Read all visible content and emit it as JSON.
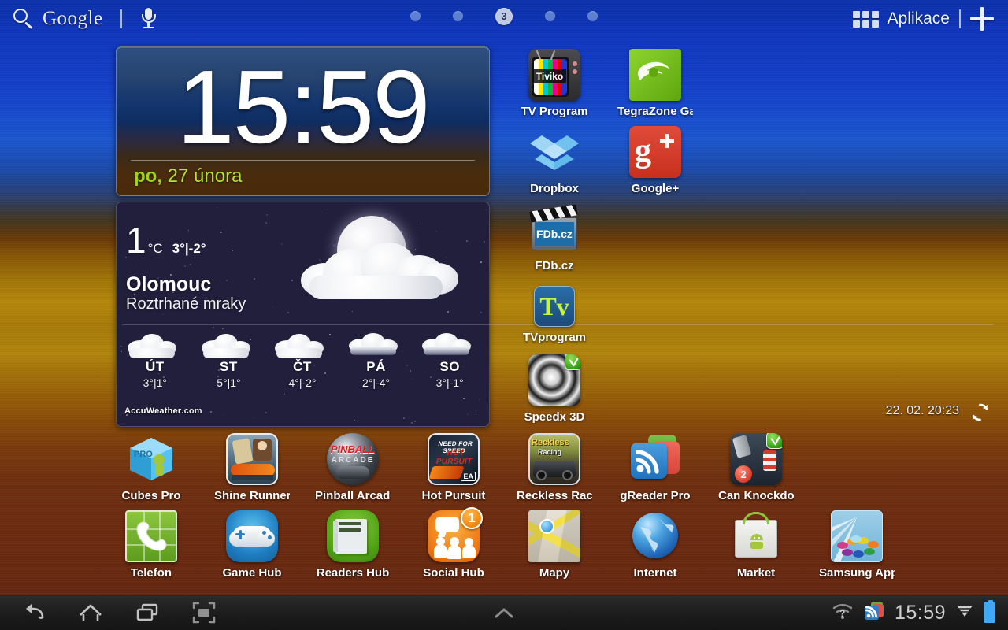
{
  "topbar": {
    "google_label": "Google",
    "search_icon": "search-icon",
    "mic_icon": "microphone-icon",
    "apps_label": "Aplikace",
    "apps_grid_icon": "apps-grid-icon",
    "add_icon": "plus-icon",
    "page_dots": [
      "",
      "",
      "3",
      "",
      ""
    ],
    "active_page": "3",
    "active_page_index": 2
  },
  "clock_widget": {
    "time": "15:59",
    "day_of_week": "po,",
    "date": "27 února"
  },
  "weather_widget": {
    "temp": "1",
    "unit": "°C",
    "high_low": "3°|-2°",
    "city": "Olomouc",
    "condition": "Roztrhané mraky",
    "condition_icon": "moon-behind-clouds-icon",
    "brand": "AccuWeather",
    "brand_suffix": ".com",
    "updated": "22. 02. 20:23",
    "refresh_icon": "refresh-icon",
    "forecast": [
      {
        "day": "ÚT",
        "temps": "3°|1°",
        "icon": "cloudy-icon"
      },
      {
        "day": "ST",
        "temps": "5°|1°",
        "icon": "cloudy-icon"
      },
      {
        "day": "ČT",
        "temps": "4°|-2°",
        "icon": "cloudy-icon"
      },
      {
        "day": "PÁ",
        "temps": "2°|-4°",
        "icon": "cloudy-snow-icon"
      },
      {
        "day": "SO",
        "temps": "3°|-1°",
        "icon": "cloudy-snow-icon"
      }
    ]
  },
  "apps": {
    "tv_program": "TV Program",
    "tegrazone": "TegraZone Ga",
    "dropbox": "Dropbox",
    "google_plus": "Google+",
    "fdb": "FDb.cz",
    "tvprogram": "TVprogram",
    "speedx": "Speedx 3D",
    "cubes_pro": "Cubes Pro",
    "shine_runner": "Shine Runner",
    "pinball": "Pinball Arcade",
    "hot_pursuit": "Hot Pursuit",
    "reckless": "Reckless Racir",
    "greader": "gReader Pro",
    "can_knockdown": "Can Knockdov",
    "telefon": "Telefon",
    "game_hub": "Game Hub",
    "readers_hub": "Readers Hub",
    "social_hub": "Social Hub",
    "social_hub_badge": "1",
    "mapy": "Mapy",
    "internet": "Internet",
    "market": "Market",
    "samsung_apps": "Samsung App",
    "tiviko_text": "Tiviko",
    "fdb_text": "FDb.cz",
    "tv_text": "Tv",
    "pro_text": "PRO",
    "pinball_text": "PINBALL",
    "pinball_sub": "ARCADE",
    "nfs_top": "NEED FOR SPEED",
    "nfs_sub": "HOT PURSUIT",
    "nfs_ea": "EA",
    "reckless_top": "Reckless",
    "reckless_sub": "Racing",
    "can_number": "2"
  },
  "sysbar": {
    "back_icon": "back-arrow-icon",
    "home_icon": "home-icon",
    "recents_icon": "recent-apps-icon",
    "screenshot_icon": "screenshot-icon",
    "chevron_up_icon": "chevron-up-icon",
    "wifi_icon": "wifi-question-icon",
    "notification_icon": "greader-notification-icon",
    "clock": "15:59",
    "signal_icon": "signal-bars-icon",
    "battery_icon": "battery-icon"
  },
  "colors": {
    "accent_green": "#9ed41e",
    "wallpaper_top": "#0a2fa8",
    "wallpaper_mid": "#b4860a",
    "wallpaper_bottom": "#5d2410",
    "battery_blue": "#3fa9f5"
  }
}
